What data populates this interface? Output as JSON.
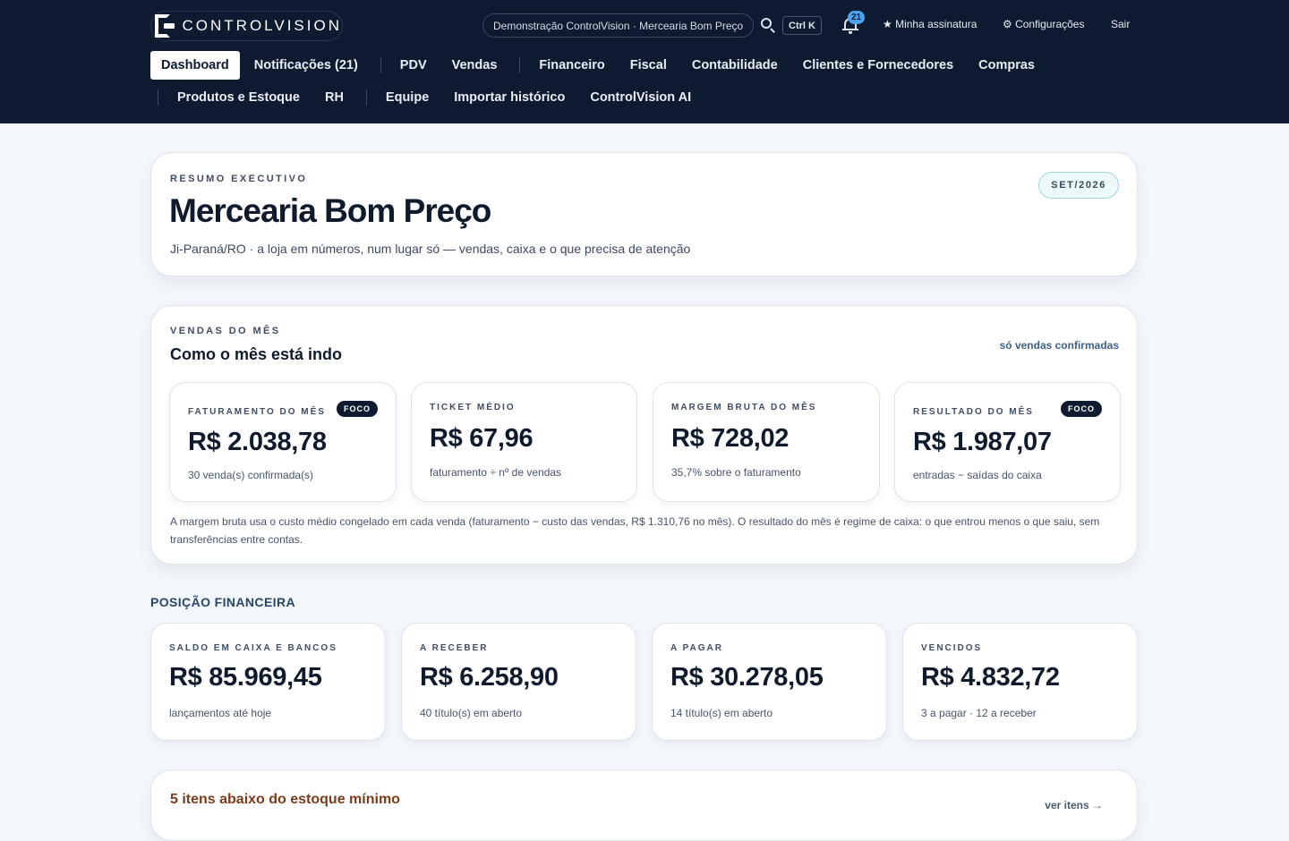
{
  "brand": {
    "name": "CONTROLVISION"
  },
  "header": {
    "context": "Demonstração ControlVision · Mercearia Bom Preço",
    "shortcut": "Ctrl K",
    "notifications_count": "21",
    "subscription": "★ Minha assinatura",
    "settings": "⚙ Configurações",
    "logout": "Sair"
  },
  "nav": {
    "row1": [
      "Dashboard",
      "Notificações (21)",
      "PDV",
      "Vendas",
      "Financeiro",
      "Fiscal",
      "Contabilidade",
      "Clientes e Fornecedores",
      "Compras"
    ],
    "row2": [
      "Produtos e Estoque",
      "RH",
      "Equipe",
      "Importar histórico",
      "ControlVision AI"
    ],
    "active": "Dashboard"
  },
  "hero": {
    "eyebrow": "RESUMO EXECUTIVO",
    "title": "Mercearia Bom Preço",
    "subtitle": "Ji-Paraná/RO · a loja em números, num lugar só — vendas, caixa e o que precisa de atenção",
    "period": "SET/2026"
  },
  "sales": {
    "eyebrow": "VENDAS DO MÊS",
    "title": "Como o mês está indo",
    "note": "só vendas confirmadas",
    "metrics": [
      {
        "label": "FATURAMENTO DO MÊS",
        "badge": "FOCO",
        "value": "R$ 2.038,78",
        "sub": "30 venda(s) confirmada(s)"
      },
      {
        "label": "TICKET MÉDIO",
        "value": "R$ 67,96",
        "sub": "faturamento ÷ nº de vendas"
      },
      {
        "label": "MARGEM BRUTA DO MÊS",
        "value": "R$ 728,02",
        "sub": "35,7% sobre o faturamento"
      },
      {
        "label": "RESULTADO DO MÊS",
        "badge": "FOCO",
        "value": "R$ 1.987,07",
        "sub": "entradas − saídas do caixa"
      }
    ],
    "footnote": "A margem bruta usa o custo médio congelado em cada venda (faturamento − custo das vendas, R$ 1.310,76 no mês). O resultado do mês é regime de caixa: o que entrou menos o que saiu, sem transferências entre contas."
  },
  "financial": {
    "title": "POSIÇÃO FINANCEIRA",
    "cards": [
      {
        "label": "SALDO EM CAIXA E BANCOS",
        "value": "R$ 85.969,45",
        "sub": "lançamentos até hoje"
      },
      {
        "label": "A RECEBER",
        "value": "R$ 6.258,90",
        "sub": "40 título(s) em aberto"
      },
      {
        "label": "A PAGAR",
        "value": "R$ 30.278,05",
        "sub": "14 título(s) em aberto"
      },
      {
        "label": "VENCIDOS",
        "value": "R$ 4.832,72",
        "sub": "3 a pagar · 12 a receber"
      }
    ]
  },
  "stock": {
    "title": "5 itens abaixo do estoque mínimo",
    "link": "ver itens →"
  }
}
